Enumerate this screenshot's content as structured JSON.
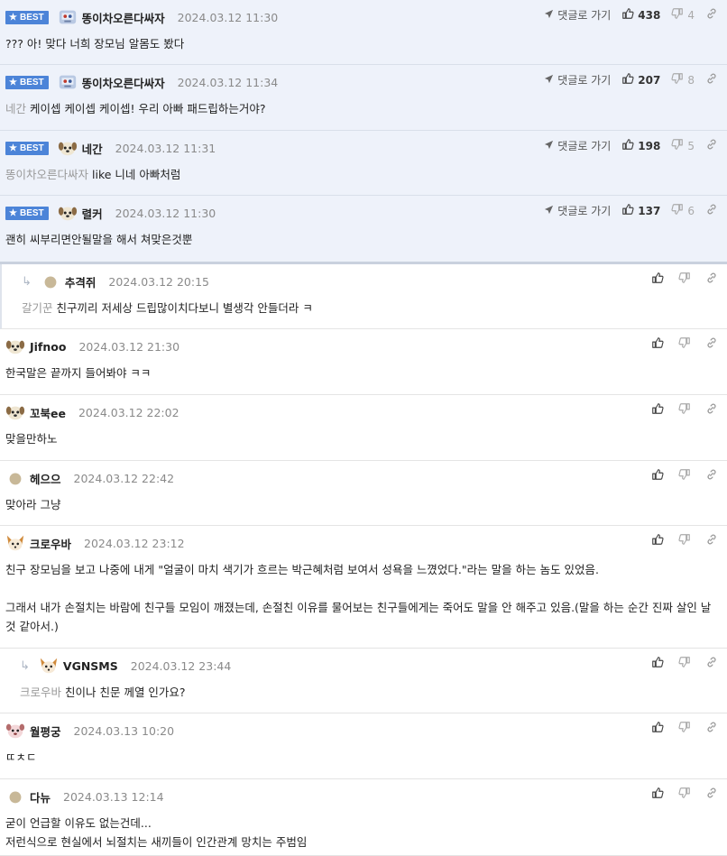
{
  "labels": {
    "best": "BEST",
    "goto": "댓글로 가기"
  },
  "colors": {
    "best_bg": "#eef2fa",
    "badge": "#4c84d8"
  },
  "comments": [
    {
      "best": true,
      "avatar": "robot-avatar",
      "nick": "똥이차오른다싸자",
      "date": "2024.03.12 11:30",
      "mention": "",
      "text": [
        "??? 아! 맞다 너희 장모님 알몸도 봤다"
      ],
      "up": "438",
      "down": "4"
    },
    {
      "best": true,
      "avatar": "robot-avatar",
      "nick": "똥이차오른다싸자",
      "date": "2024.03.12 11:34",
      "mention": "네간",
      "text": [
        "케이셉 케이셉 케이셉! 우리 아빠 패드립하는거야?"
      ],
      "up": "207",
      "down": "8"
    },
    {
      "best": true,
      "avatar": "dog-avatar",
      "nick": "네간",
      "date": "2024.03.12 11:31",
      "mention": "똥이차오른다싸자",
      "text": [
        "like 니네 아빠처럼"
      ],
      "up": "198",
      "down": "5"
    },
    {
      "best": true,
      "avatar": "dog-avatar",
      "nick": "렬커",
      "date": "2024.03.12 11:30",
      "mention": "",
      "text": [
        "괜히 씨부리면안될말을 해서 쳐맞은것뿐"
      ],
      "up": "137",
      "down": "6"
    },
    {
      "reply": true,
      "avatar": "dot-avatar",
      "nick": "추격쥐",
      "date": "2024.03.12 20:15",
      "mention": "갈기꾼",
      "text": [
        "친구끼리 저세상 드립많이치다보니 별생각 안들더라 ㅋ"
      ]
    },
    {
      "avatar": "dog-avatar",
      "nick": "Jifnoo",
      "date": "2024.03.12 21:30",
      "mention": "",
      "text": [
        "한국말은 끝까지 들어봐야 ㅋㅋ"
      ]
    },
    {
      "avatar": "dog-avatar",
      "nick": "꼬북ee",
      "date": "2024.03.12 22:02",
      "mention": "",
      "text": [
        "맞을만하노"
      ]
    },
    {
      "avatar": "dot-avatar",
      "nick": "헤으으",
      "date": "2024.03.12 22:42",
      "mention": "",
      "text": [
        "맞아라 그냥"
      ]
    },
    {
      "avatar": "fox-avatar",
      "nick": "크로우바",
      "date": "2024.03.12 23:12",
      "mention": "",
      "text": [
        "친구 장모님을 보고 나중에 내게 \"얼굴이 마치 색기가 흐르는 박근혜처럼 보여서 성욕을 느꼈었다.\"라는 말을 하는 놈도 있었음.",
        "",
        "그래서 내가 손절치는 바람에 친구들 모임이 깨졌는데, 손절친 이유를 물어보는 친구들에게는 죽어도 말을 안 해주고 있음.(말을 하는 순간 진짜 살인 날 것 같아서.)"
      ]
    },
    {
      "reply": true,
      "avatar": "fox-avatar",
      "nick": "VGNSMS",
      "date": "2024.03.12 23:44",
      "mention": "크로우바",
      "text": [
        "친이나 친문 께열 인가요?"
      ]
    },
    {
      "avatar": "pink-avatar",
      "nick": "월평궁",
      "date": "2024.03.13 10:20",
      "mention": "",
      "text": [
        "ㄸㅊㄷ"
      ]
    },
    {
      "avatar": "dot-avatar",
      "nick": "다뉴",
      "date": "2024.03.13 12:14",
      "mention": "",
      "text": [
        "굳이 언급할 이유도 없는건데...",
        "저런식으로 현실에서 뇌절치는 새끼들이 인간관계 망치는 주범임"
      ]
    }
  ]
}
